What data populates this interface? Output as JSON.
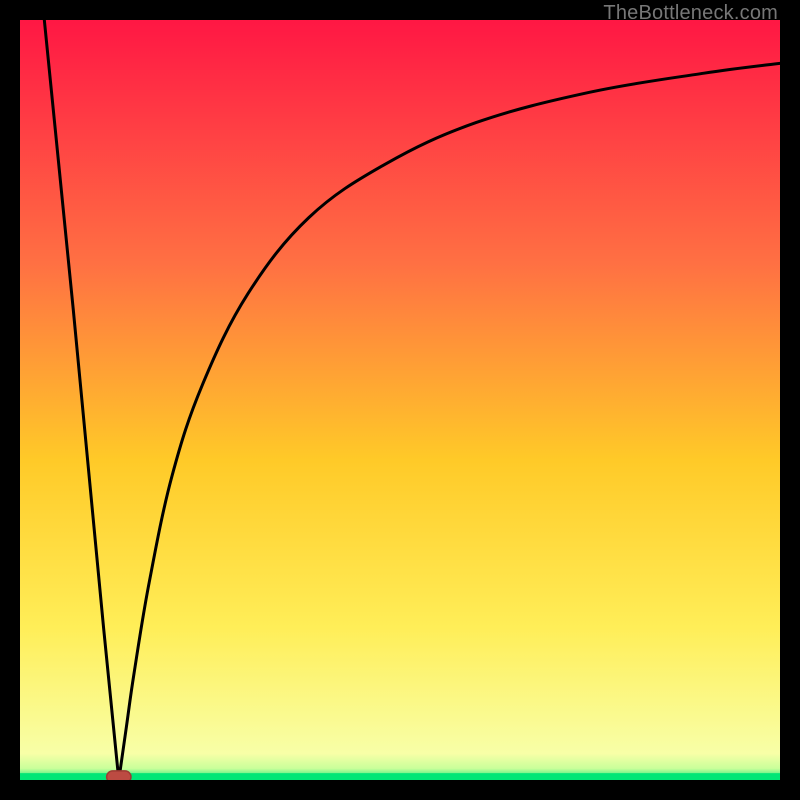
{
  "watermark": "TheBottleneck.com",
  "colors": {
    "frame": "#000000",
    "gradient_top": "#ff1744",
    "gradient_mid1": "#ff7043",
    "gradient_mid2": "#ffca28",
    "gradient_mid3": "#ffee58",
    "gradient_bottom": "#f8ffa7",
    "green_line": "#00e676",
    "curve": "#000000",
    "marker_fill": "#bc4b42",
    "marker_stroke": "#a03a33"
  },
  "chart_data": {
    "type": "line",
    "title": "",
    "xlabel": "",
    "ylabel": "",
    "xlim": [
      0,
      100
    ],
    "ylim": [
      0,
      100
    ],
    "notes": "Heatmap-style vertical gradient background (red top → green bottom). Black curve shows bottleneck deviation; dips to 0 at the optimal point then rises asymptotically. Small rounded marker at the minimum.",
    "optimal_x": 13,
    "series": [
      {
        "name": "bottleneck-curve-left",
        "x": [
          3.2,
          5,
          7,
          9,
          11,
          12.2,
          13
        ],
        "values": [
          100,
          82,
          62,
          41,
          20,
          8,
          0
        ]
      },
      {
        "name": "bottleneck-curve-right",
        "x": [
          13,
          14,
          15,
          17,
          20,
          24,
          30,
          38,
          48,
          60,
          75,
          90,
          100
        ],
        "values": [
          0,
          7,
          14,
          26,
          40,
          52,
          64,
          74,
          81,
          86.5,
          90.5,
          93,
          94.3
        ]
      }
    ],
    "marker": {
      "x": 13,
      "y": 0,
      "width_pct": 3.2,
      "height_pct": 1.6
    }
  }
}
